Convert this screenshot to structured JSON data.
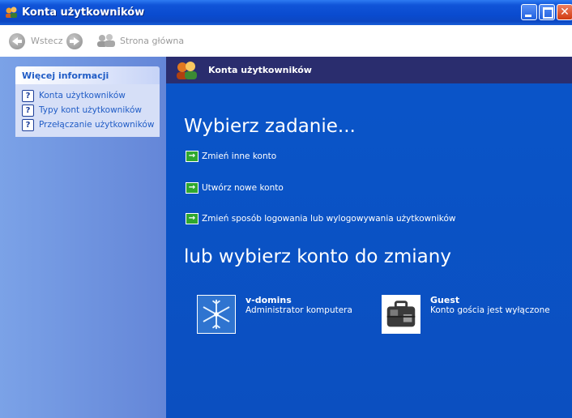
{
  "window": {
    "title": "Konta użytkowników"
  },
  "toolbar": {
    "back_label": "Wstecz",
    "home_label": "Strona główna"
  },
  "left_pane": {
    "panel_title": "Więcej informacji",
    "links": [
      "Konta użytkowników",
      "Typy kont użytkowników",
      "Przełączanie użytkowników"
    ]
  },
  "main": {
    "header_title": "Konta użytkowników",
    "heading_tasks": "Wybierz zadanie...",
    "tasks": [
      "Zmień inne konto",
      "Utwórz nowe konto",
      "Zmień sposób logowania lub wylogowywania użytkowników"
    ],
    "heading_accounts": "lub wybierz konto do zmiany",
    "accounts": [
      {
        "name": "v-domins",
        "description": "Administrator komputera",
        "picture": "snowflake-icon"
      },
      {
        "name": "Guest",
        "description": "Konto gościa jest wyłączone",
        "picture": "briefcase-icon"
      }
    ]
  },
  "colors": {
    "title_bar": "#0a4bcf",
    "main_background": "#0b4fc0",
    "header_bar": "#2a2d6e",
    "left_pane": "#6f96df",
    "task_arrow": "#2fa82f",
    "close_button": "#d03a10"
  }
}
